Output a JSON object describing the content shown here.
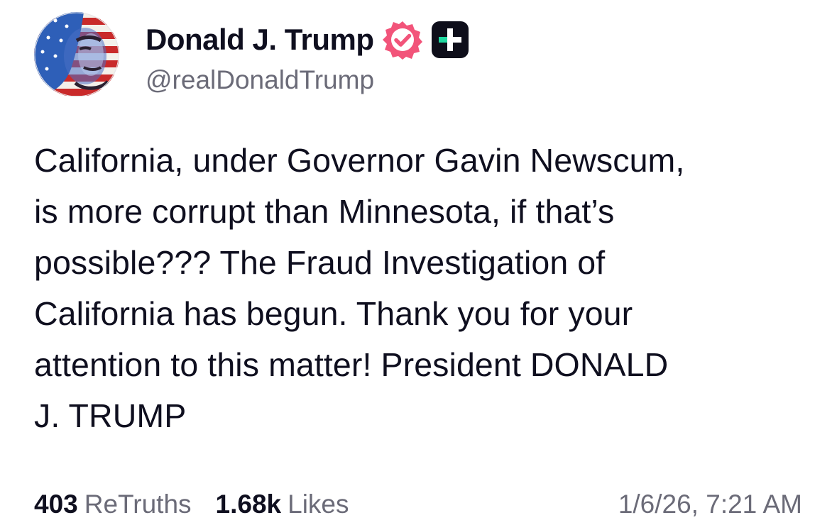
{
  "author": {
    "display_name": "Donald J. Trump",
    "handle": "@realDonaldTrump",
    "avatar_icon": "avatar-portrait-flag",
    "verified_icon": "verified-badge-icon",
    "verified_color": "#f2547a",
    "plus_icon": "plus-badge-icon",
    "plus_accent": "#1fd8a0"
  },
  "post": {
    "lines": [
      "California, under Governor Gavin Newscum,",
      "is more corrupt than Minnesota, if that’s",
      "possible??? The Fraud Investigation of",
      "California has begun. Thank you for your",
      "attention to this matter! President DONALD",
      "J. TRUMP"
    ]
  },
  "stats": {
    "retruths_count": "403",
    "retruths_label": "ReTruths",
    "likes_count": "1.68k",
    "likes_label": "Likes",
    "timestamp": "1/6/26, 7:21 AM"
  }
}
